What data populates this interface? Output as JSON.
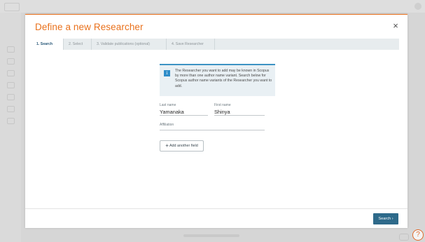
{
  "modal": {
    "title": "Define a new Researcher",
    "close_label": "×"
  },
  "steps": [
    {
      "label": "1. Search",
      "active": true
    },
    {
      "label": "2. Select",
      "active": false
    },
    {
      "label": "3. Validate publications (optional)",
      "active": false
    },
    {
      "label": "4. Save Researcher",
      "active": false
    }
  ],
  "info": {
    "icon": "info-icon",
    "icon_glyph": "i",
    "text": "The Researcher you want to add may be known in Scopus by more than one author name variant. Search below for Scopus author name variants of the Researcher you want to add."
  },
  "form": {
    "last_name_label": "Last name",
    "last_name_value": "Yamanaka",
    "first_name_label": "First name",
    "first_name_value": "Shinya",
    "affiliation_label": "Affiliation",
    "affiliation_value": "",
    "add_field_label": "Add another field",
    "add_field_icon": "+"
  },
  "footer": {
    "search_label": "Search ›"
  },
  "help": {
    "icon": "help-icon",
    "glyph": "?"
  },
  "colors": {
    "accent": "#e9711c",
    "primary_button": "#2e6a8a",
    "info_border": "#3d93c4"
  }
}
